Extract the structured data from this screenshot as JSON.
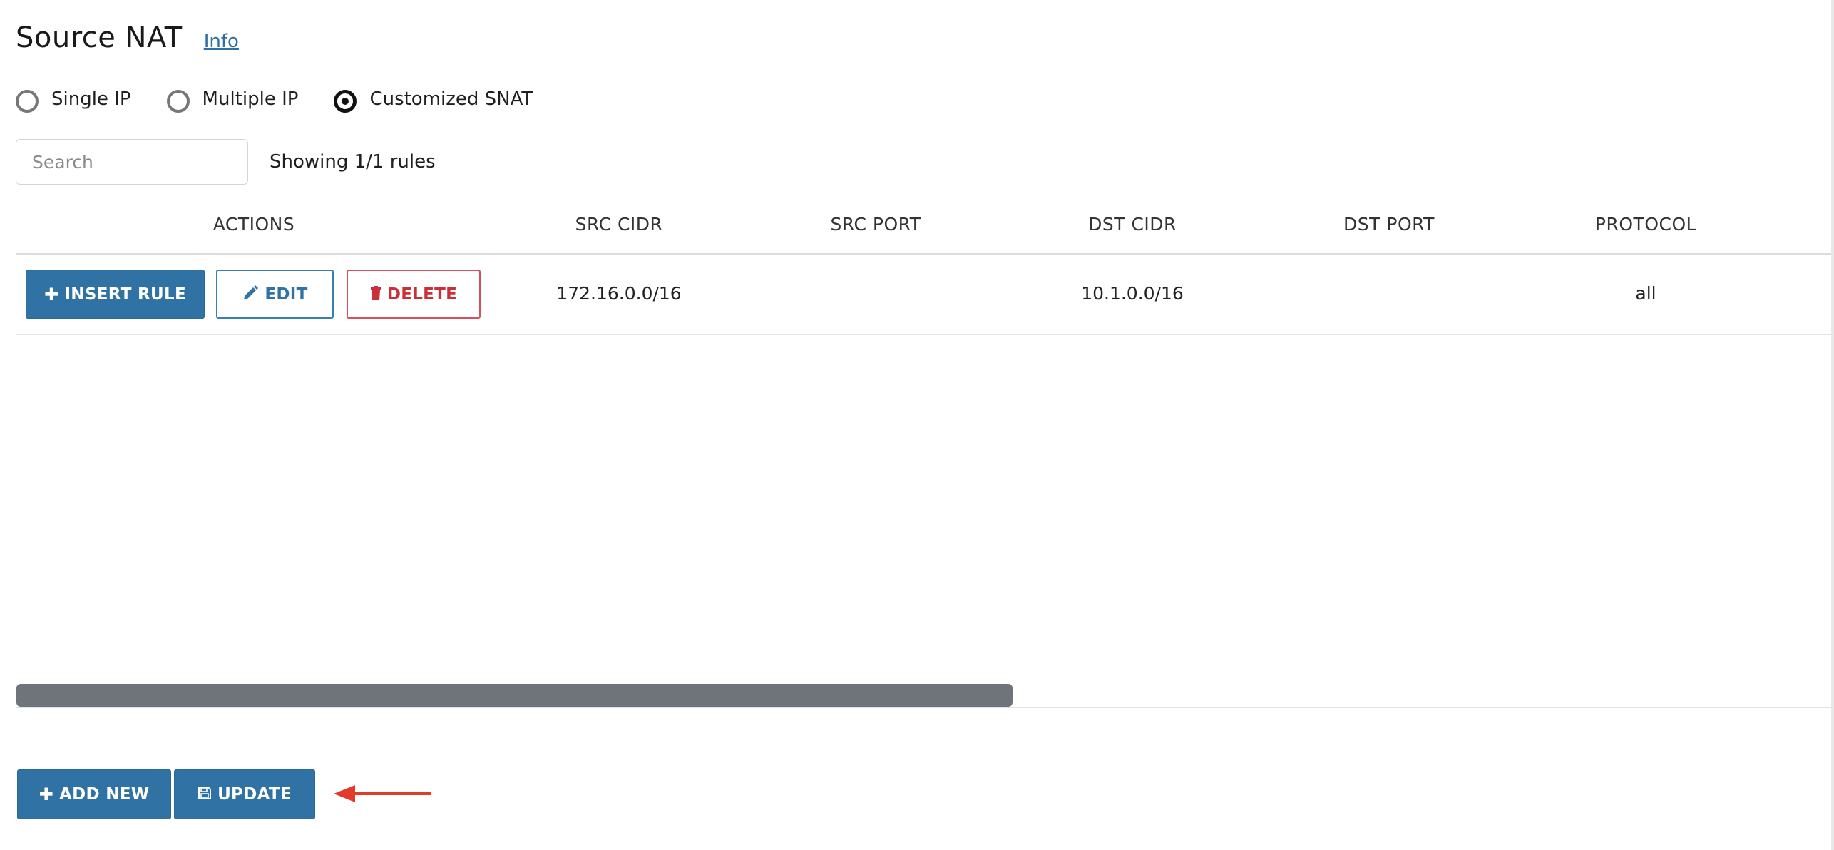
{
  "header": {
    "title": "Source NAT",
    "info_link": "Info"
  },
  "mode_options": [
    {
      "label": "Single IP",
      "checked": false
    },
    {
      "label": "Multiple IP",
      "checked": false
    },
    {
      "label": "Customized SNAT",
      "checked": true
    }
  ],
  "search": {
    "placeholder": "Search",
    "value": ""
  },
  "showing_text": "Showing 1/1 rules",
  "table": {
    "columns": [
      "ACTIONS",
      "SRC CIDR",
      "SRC PORT",
      "DST CIDR",
      "DST PORT",
      "PROTOCOL"
    ],
    "rows": [
      {
        "src_cidr": "172.16.0.0/16",
        "src_port": "",
        "dst_cidr": "10.1.0.0/16",
        "dst_port": "",
        "protocol": "all"
      }
    ],
    "row_actions": {
      "insert_label": "INSERT RULE",
      "edit_label": "EDIT",
      "delete_label": "DELETE"
    }
  },
  "footer": {
    "add_new_label": "ADD NEW",
    "update_label": "UPDATE"
  },
  "icons": {
    "plus": "plus-icon",
    "pencil": "pencil-icon",
    "trash": "trash-icon",
    "save": "save-icon",
    "arrow": "arrow-left-icon"
  },
  "colors": {
    "primary": "#2f72a3",
    "danger": "#c9303a",
    "annotation_arrow": "#e23b2a"
  }
}
